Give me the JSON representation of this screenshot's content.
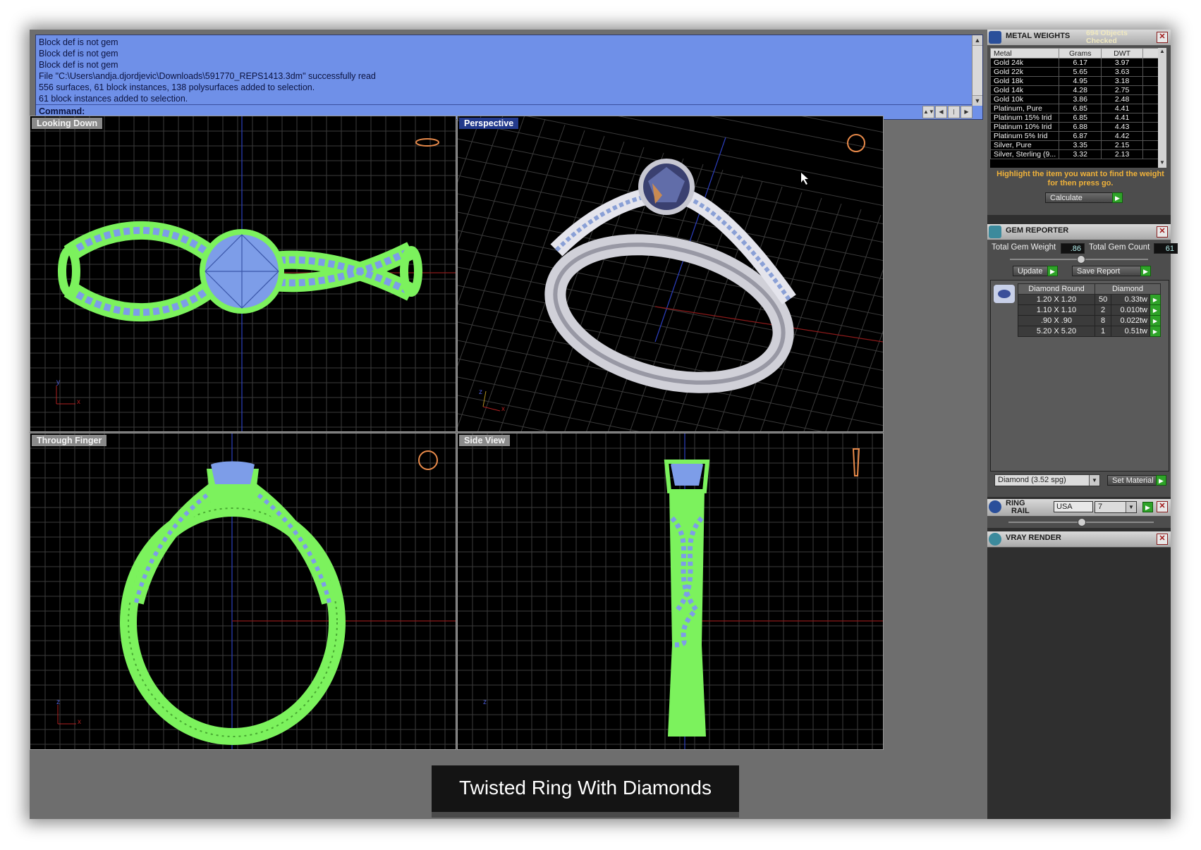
{
  "command_history": [
    "Block def is not gem",
    "Block def is not gem",
    "Block def is not gem",
    "File \"C:\\Users\\andja.djordjevic\\Downloads\\591770_REPS1413.3dm\" successfully read",
    "556 surfaces, 61 block instances, 138 polysurfaces added to selection.",
    "61 block instances added to selection."
  ],
  "command_prompt": "Command:",
  "viewports": {
    "top_left": {
      "label": "Looking Down",
      "axis_a": "x",
      "axis_b": "y"
    },
    "top_right": {
      "label": "Perspective",
      "axis_a": "x",
      "axis_b": "z"
    },
    "bottom_left": {
      "label": "Through Finger",
      "axis_a": "x",
      "axis_b": "z"
    },
    "bottom_right": {
      "label": "Side View",
      "axis_b": "z"
    }
  },
  "active_viewport": "Perspective",
  "caption": "Twisted Ring With Diamonds",
  "metal_weights": {
    "title": "METAL WEIGHTS",
    "objects_checked": "694 Objects Checked",
    "columns": [
      "Metal",
      "Grams",
      "DWT"
    ],
    "rows": [
      [
        "Gold 24k",
        "6.17",
        "3.97"
      ],
      [
        "Gold 22k",
        "5.65",
        "3.63"
      ],
      [
        "Gold 18k",
        "4.95",
        "3.18"
      ],
      [
        "Gold 14k",
        "4.28",
        "2.75"
      ],
      [
        "Gold 10k",
        "3.86",
        "2.48"
      ],
      [
        "Platinum, Pure",
        "6.85",
        "4.41"
      ],
      [
        "Platinum 15% Irid",
        "6.85",
        "4.41"
      ],
      [
        "Platinum 10% Irid",
        "6.88",
        "4.43"
      ],
      [
        "Platinum 5% Irid",
        "6.87",
        "4.42"
      ],
      [
        "Silver, Pure",
        "3.35",
        "2.15"
      ],
      [
        "Silver, Sterling (9...",
        "3.32",
        "2.13"
      ]
    ],
    "hint": "Highlight the item you want to find the weight for then press go.",
    "calculate_label": "Calculate"
  },
  "gem_reporter": {
    "title": "GEM REPORTER",
    "total_weight_label": "Total Gem Weight",
    "total_weight_value": ".86",
    "total_count_label": "Total Gem Count",
    "total_count_value": "61",
    "update_label": "Update",
    "save_report_label": "Save Report",
    "columns": [
      "Diamond Round",
      "Diamond"
    ],
    "rows": [
      [
        "1.20 X 1.20",
        "50",
        "0.33tw"
      ],
      [
        "1.10 X 1.10",
        "2",
        "0.010tw"
      ],
      [
        ".90 X .90",
        "8",
        "0.022tw"
      ],
      [
        "5.20 X 5.20",
        "1",
        "0.51tw"
      ]
    ],
    "material_value": "Diamond   (3.52 spg)",
    "set_material_label": "Set Material"
  },
  "ring_rail": {
    "title_line1": "RING",
    "title_line2": "RAIL",
    "standard": "USA",
    "size": "7"
  },
  "vray": {
    "title": "VRAY RENDER"
  },
  "colors": {
    "command_bg": "#6f90e8",
    "wire_green": "#7cf25d",
    "gem_blue": "#7d9de8",
    "accent_go": "#2fa329",
    "hint_orange": "#f0b23a"
  }
}
